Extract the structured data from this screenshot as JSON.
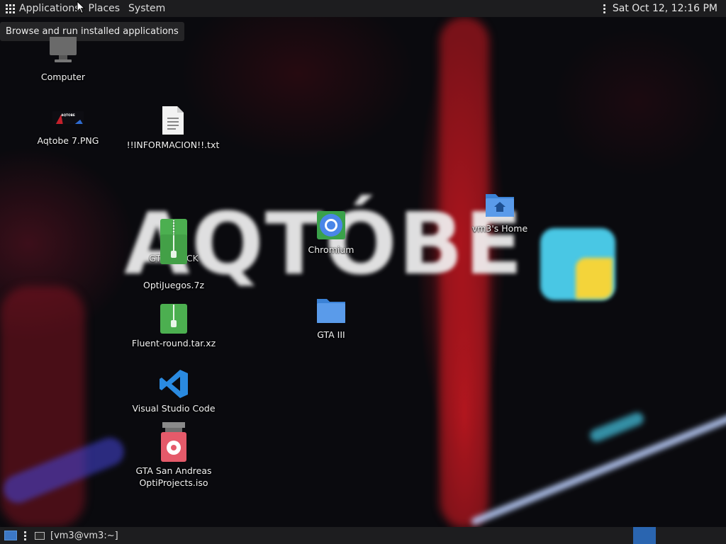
{
  "top_panel": {
    "menus": [
      "Applications",
      "Places",
      "System"
    ],
    "clock": "Sat Oct 12, 12:16 PM"
  },
  "tooltip": "Browse and run installed applications",
  "wallpaper": {
    "logo_text": "AQTÓBE",
    "colors": {
      "logo": "#f2f2f2",
      "square_cyan": "#49c7e4",
      "square_yellow": "#f4d43a",
      "streak_red": "#d11a28"
    }
  },
  "desktop_icons": [
    {
      "id": "computer",
      "label": "Computer",
      "icon": "computer-icon"
    },
    {
      "id": "aqtobe-png",
      "label": "Aqtobe 7.PNG",
      "icon": "image-icon"
    },
    {
      "id": "informacion",
      "label": "!!INFORMACION!!.txt",
      "icon": "text-file-icon"
    },
    {
      "id": "gta-archive-a",
      "label": "GTA ... ACK",
      "icon": "archive-icon"
    },
    {
      "id": "gta-archive-b",
      "label": "OptiJuegos.7z",
      "icon": "archive-icon"
    },
    {
      "id": "chromium",
      "label": "Chromium",
      "icon": "chromium-icon"
    },
    {
      "id": "home",
      "label": "vm3's Home",
      "icon": "home-folder-icon"
    },
    {
      "id": "gta-iii",
      "label": "GTA III",
      "icon": "folder-icon"
    },
    {
      "id": "fluent",
      "label": "Fluent-round.tar.xz",
      "icon": "archive-icon"
    },
    {
      "id": "vscode",
      "label": "Visual Studio Code",
      "icon": "vscode-icon"
    },
    {
      "id": "gta-sa-iso",
      "label": "GTA San Andreas\nOptiProjects.iso",
      "icon": "disc-image-icon"
    }
  ],
  "bottom_panel": {
    "task": "[vm3@vm3:~]"
  }
}
